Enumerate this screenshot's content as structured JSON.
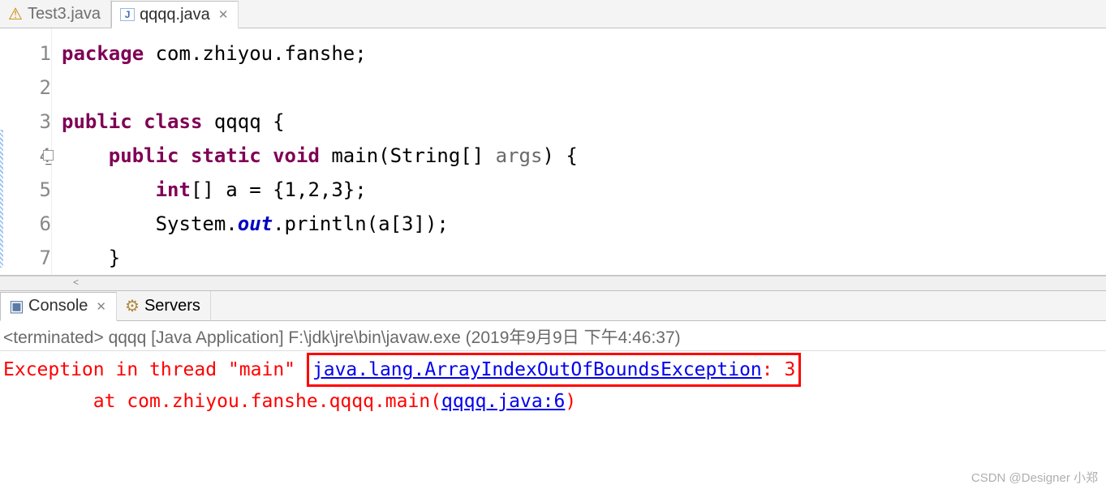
{
  "tabs": {
    "inactive": {
      "label": "Test3.java"
    },
    "active": {
      "label": "qqqq.java"
    }
  },
  "code": {
    "lines": [
      "1",
      "2",
      "3",
      "4",
      "5",
      "6",
      "7"
    ],
    "l1": {
      "kw1": "package",
      "rest": " com.zhiyou.fanshe;"
    },
    "l3": {
      "kw1": "public",
      "kw2": "class",
      "name": " qqqq {"
    },
    "l4": {
      "indent": "    ",
      "kw1": "public",
      "kw2": "static",
      "kw3": "void",
      "sig_a": " main(String[] ",
      "arg": "args",
      "sig_b": ") {"
    },
    "l5": {
      "indent": "        ",
      "kw1": "int",
      "rest": "[] a = {1,2,3};"
    },
    "l6": {
      "indent": "        ",
      "a": "System.",
      "out": "out",
      "b": ".println(a[3]);"
    },
    "l7": {
      "indent": "    }",
      "rest": ""
    }
  },
  "console": {
    "tab1": "Console",
    "tab2": "Servers",
    "desc": "<terminated> qqqq [Java Application] F:\\jdk\\jre\\bin\\javaw.exe (2019年9月9日 下午4:46:37)",
    "line1_a": "Exception in thread \"main\" ",
    "line1_link": "java.lang.ArrayIndexOutOfBoundsException",
    "line1_b": ": 3",
    "line2_a": "        at com.zhiyou.fanshe.qqqq.main(",
    "line2_link": "qqqq.java:6",
    "line2_b": ")"
  },
  "watermark": "CSDN @Designer 小郑",
  "icons": {
    "java_warning": "⚠",
    "java_file": "J",
    "close": "✕",
    "console": "🖵",
    "servers": "⚙"
  }
}
